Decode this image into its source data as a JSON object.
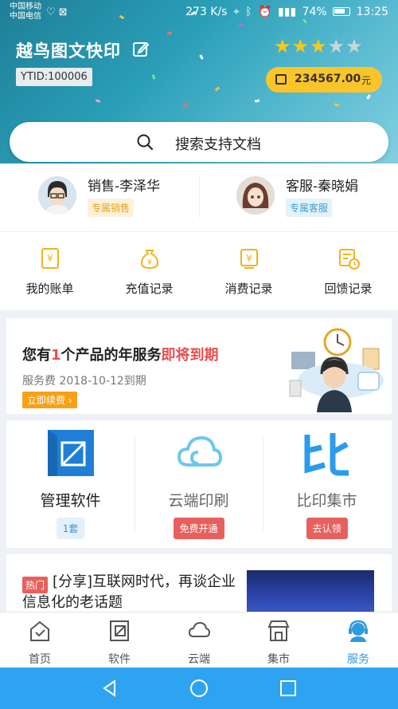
{
  "status_bar": {
    "carrier_1": "中国移动",
    "carrier_2": "中国电信",
    "net_speed": "273 K/s",
    "battery": "74%",
    "time": "13:25"
  },
  "header": {
    "shop_name": "越鸟图文快印",
    "rating": 3,
    "rating_max": 5,
    "ytid": "YTID:100006",
    "balance": "234567.00",
    "balance_unit": "元"
  },
  "search": {
    "placeholder": "搜索支持文档"
  },
  "contacts": [
    {
      "name": "销售-李泽华",
      "tag": "专属销售"
    },
    {
      "name": "客服-秦晓娟",
      "tag": "专属客服"
    }
  ],
  "quick_menu": [
    {
      "label": "我的账单",
      "icon": "bill-icon"
    },
    {
      "label": "充值记录",
      "icon": "money-bag-icon"
    },
    {
      "label": "消费记录",
      "icon": "yen-receipt-icon"
    },
    {
      "label": "回馈记录",
      "icon": "feedback-clock-icon"
    }
  ],
  "expiry_banner": {
    "title_pre": "您有",
    "count": "1",
    "title_mid": "个产品的年服务",
    "title_hl": "即将到期",
    "subtitle": "服务费 2018-10-12到期",
    "renew_label": "立即续费 ›"
  },
  "products": [
    {
      "name": "管理软件",
      "badge": "1套"
    },
    {
      "name": "云端印刷",
      "badge": "免费开通"
    },
    {
      "name": "比印集市",
      "badge": "去认领"
    }
  ],
  "article": {
    "hot_tag": "热门",
    "title": "[分享]互联网时代，再谈企业信息化的老话题"
  },
  "tabs": [
    {
      "label": "首页",
      "icon": "home-icon",
      "active": false
    },
    {
      "label": "软件",
      "icon": "software-icon",
      "active": false
    },
    {
      "label": "云端",
      "icon": "cloud-icon",
      "active": false
    },
    {
      "label": "集市",
      "icon": "market-icon",
      "active": false
    },
    {
      "label": "服务",
      "icon": "service-headset-icon",
      "active": true
    }
  ],
  "colors": {
    "accent_blue": "#2ea3f2",
    "balance_yellow": "#fbc52a",
    "alert_red": "#e84e4e",
    "renew_orange": "#f7a11a"
  }
}
